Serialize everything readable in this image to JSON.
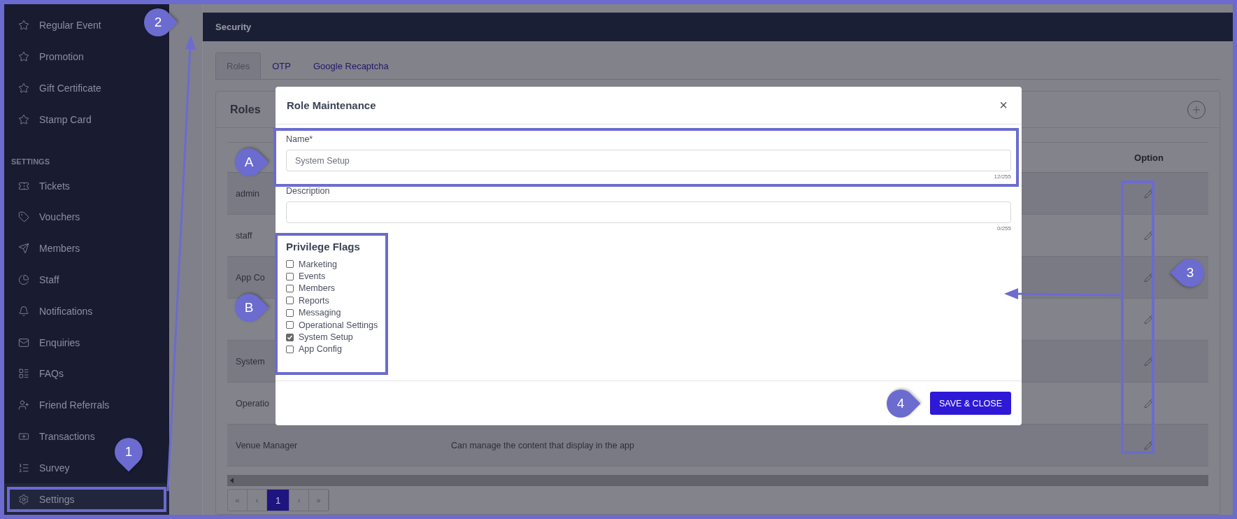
{
  "sidebar": {
    "groups": [
      {
        "items": [
          {
            "label": "Regular Event",
            "selected": false
          },
          {
            "label": "Promotion",
            "selected": false
          },
          {
            "label": "Gift Certificate",
            "selected": false
          },
          {
            "label": "Stamp Card",
            "selected": false
          }
        ]
      },
      {
        "heading": "SETTINGS",
        "items": [
          {
            "label": "Tickets",
            "selected": false
          },
          {
            "label": "Vouchers",
            "selected": false
          },
          {
            "label": "Members",
            "selected": false
          },
          {
            "label": "Staff",
            "selected": false
          },
          {
            "label": "Notifications",
            "selected": false
          },
          {
            "label": "Enquiries",
            "selected": false
          },
          {
            "label": "FAQs",
            "selected": false
          },
          {
            "label": "Friend Referrals",
            "selected": false
          },
          {
            "label": "Transactions",
            "selected": false
          },
          {
            "label": "Survey",
            "selected": false
          },
          {
            "label": "Settings",
            "selected": true
          }
        ]
      }
    ]
  },
  "header": {
    "title": "Security"
  },
  "tabs": [
    {
      "label": "Roles",
      "selected": true
    },
    {
      "label": "OTP",
      "selected": false
    },
    {
      "label": "Google Recaptcha",
      "selected": false
    }
  ],
  "card": {
    "title": "Roles"
  },
  "table": {
    "columns": [
      "Option"
    ],
    "rows": [
      {
        "name": "admin"
      },
      {
        "name": "staff"
      },
      {
        "name": "App Co"
      },
      {},
      {
        "name": "System"
      },
      {
        "name": "Operatio"
      },
      {
        "name": "Venue Manager",
        "description": "Can manage the content that display in the app"
      }
    ]
  },
  "pagination": {
    "first": "«",
    "prev": "‹",
    "pages": [
      {
        "label": "1",
        "selected": true
      }
    ],
    "next": "›",
    "last": "»"
  },
  "modal": {
    "title": "Role Maintenance",
    "close": "×",
    "fields": [
      {
        "label": "Name*",
        "value": "System Setup",
        "counter": "12/255"
      },
      {
        "label": "Description",
        "counter": "0/255"
      }
    ],
    "flags_title": "Privilege Flags",
    "flags": [
      {
        "label": "Marketing",
        "checked": false
      },
      {
        "label": "Events",
        "checked": false
      },
      {
        "label": "Members",
        "checked": false
      },
      {
        "label": "Reports",
        "checked": false
      },
      {
        "label": "Messaging",
        "checked": false
      },
      {
        "label": "Operational Settings",
        "checked": false
      },
      {
        "label": "System Setup",
        "checked": true
      },
      {
        "label": "App Config",
        "checked": false
      }
    ],
    "save_button": "SAVE & CLOSE"
  },
  "callouts": [
    {
      "label": "1"
    },
    {
      "label": "2"
    },
    {
      "label": "A"
    },
    {
      "label": "B"
    },
    {
      "label": "3"
    },
    {
      "label": "4"
    }
  ]
}
